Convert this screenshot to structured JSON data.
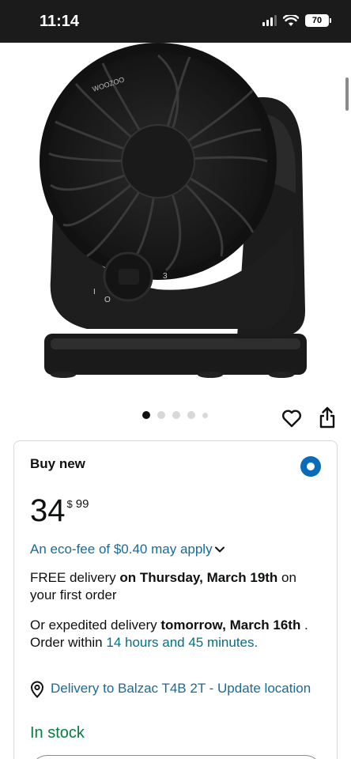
{
  "status_bar": {
    "time": "11:14",
    "battery": "70",
    "icons": [
      "signal-icon",
      "wifi-icon",
      "battery-icon"
    ]
  },
  "product_image": {
    "alt": "Black compact air circulator fan",
    "brand_mark": "WOOZOO"
  },
  "carousel": {
    "image_count": 5,
    "active_index": 0
  },
  "actions": {
    "icons": [
      "heart-icon",
      "share-icon"
    ]
  },
  "buy_box": {
    "title": "Buy new",
    "selected": true,
    "price": {
      "whole": "34",
      "currency": "$",
      "fraction": "99"
    },
    "eco_fee": "An eco-fee of $0.40 may apply",
    "delivery": {
      "prefix": "FREE delivery ",
      "date": "on Thursday, March 19th",
      "suffix": " on your first order"
    },
    "expedited": {
      "prefix": "Or expedited delivery ",
      "date": "tomorrow, March 16th",
      "middle": " . Order within ",
      "countdown": "14 hours and 45 minutes."
    },
    "location": "Delivery to Balzac T4B 2T - Update location",
    "stock": "In stock"
  },
  "colors": {
    "link": "#1a6a96",
    "teal": "#007185",
    "in_stock": "#067d3f",
    "radio": "#0a6bb8",
    "status_bar": "#1b1b1b"
  }
}
